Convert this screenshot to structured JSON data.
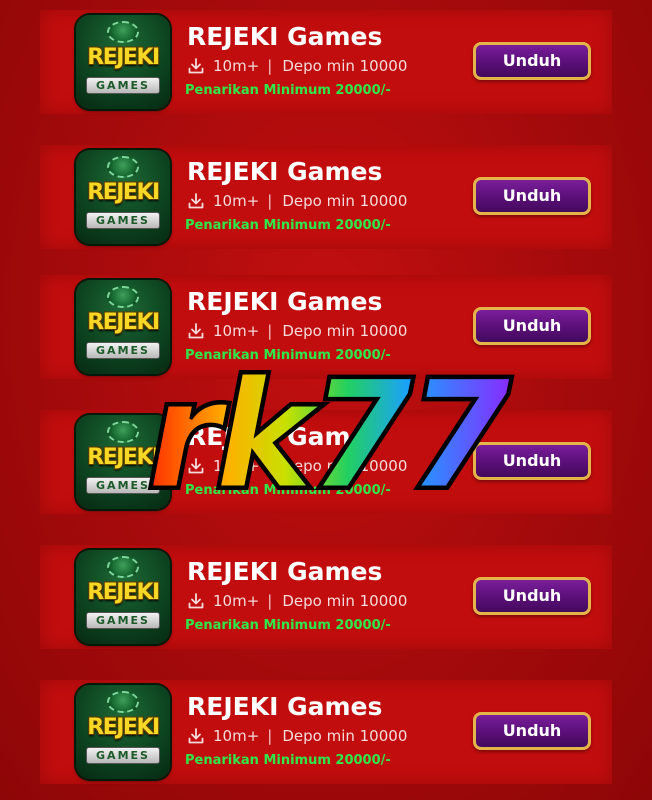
{
  "apps": [
    {
      "icon_title": "REJEKI",
      "icon_sub": "GAMES",
      "name": "REJEKI Games",
      "downloads": "10m+",
      "separator": "|",
      "deposit": "Depo min 10000",
      "note": "Penarikan Minimum 20000/-",
      "button": "Unduh"
    },
    {
      "icon_title": "REJEKI",
      "icon_sub": "GAMES",
      "name": "REJEKI Games",
      "downloads": "10m+",
      "separator": "|",
      "deposit": "Depo min 10000",
      "note": "Penarikan Minimum 20000/-",
      "button": "Unduh"
    },
    {
      "icon_title": "REJEKI",
      "icon_sub": "GAMES",
      "name": "REJEKI Games",
      "downloads": "10m+",
      "separator": "|",
      "deposit": "Depo min 10000",
      "note": "Penarikan Minimum 20000/-",
      "button": "Unduh"
    },
    {
      "icon_title": "REJEKI",
      "icon_sub": "GAMES",
      "name": "REJEKI Games",
      "downloads": "10m+",
      "separator": "|",
      "deposit": "Depo min 10000",
      "note": "Penarikan Minimum 20000/-",
      "button": "Unduh"
    },
    {
      "icon_title": "REJEKI",
      "icon_sub": "GAMES",
      "name": "REJEKI Games",
      "downloads": "10m+",
      "separator": "|",
      "deposit": "Depo min 10000",
      "note": "Penarikan Minimum 20000/-",
      "button": "Unduh"
    },
    {
      "icon_title": "REJEKI",
      "icon_sub": "GAMES",
      "name": "REJEKI Games",
      "downloads": "10m+",
      "separator": "|",
      "deposit": "Depo min 10000",
      "note": "Penarikan Minimum 20000/-",
      "button": "Unduh"
    }
  ],
  "watermark": {
    "text": "rk77"
  },
  "colors": {
    "background": "#a80a0b",
    "card": "#c20d0e",
    "title": "#ffffff",
    "note_green": "#2ee84a",
    "button_purple": "#5a0f78",
    "button_border": "#e6b54a",
    "icon_yellow": "#f7d824",
    "icon_green": "#0d4420"
  },
  "icons": {
    "download": "download-icon",
    "app_logo": "rejeki-games-logo"
  }
}
